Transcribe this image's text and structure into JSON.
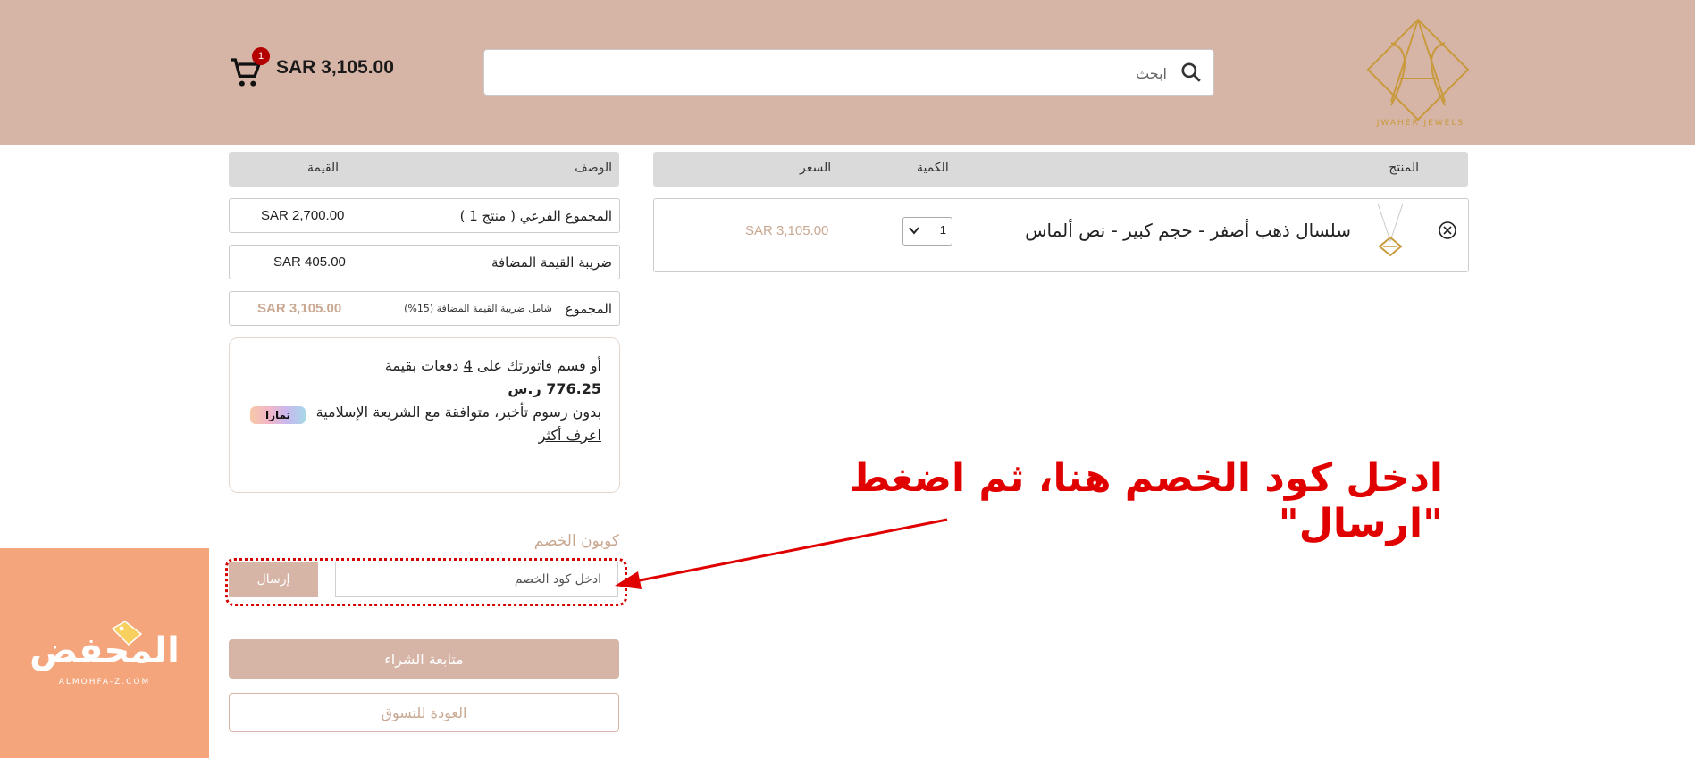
{
  "header": {
    "logo_text": "JWAHER JEWELS",
    "search_placeholder": "ابحث",
    "cart_count": "1",
    "cart_total": "SAR 3,105.00"
  },
  "cart_table": {
    "headers": {
      "product": "المنتج",
      "quantity": "الكمية",
      "price": "السعر"
    },
    "item": {
      "name": "سلسال ذهب أصفر - حجم كبير - نص ألماس",
      "quantity": "1",
      "price": "SAR 3,105.00"
    }
  },
  "summary": {
    "headers": {
      "description": "الوصف",
      "value": "القيمة"
    },
    "subtotal_label": "المجموع الفرعي ( منتج 1 )",
    "subtotal_value": "SAR 2,700.00",
    "vat_label": "ضريبة القيمة المضافة",
    "vat_value": "SAR 405.00",
    "total_label": "المجموع",
    "total_note": "شامل ضريبة القيمة المضافة (15%)",
    "total_value": "SAR 3,105.00"
  },
  "tamara": {
    "line1_pre": "أو قسم فاتورتك على",
    "installments": "4",
    "line1_post": "دفعات بقيمة",
    "amount": "776.25 ر.س",
    "line2": "بدون رسوم تأخير، متوافقة مع الشريعة الإسلامية",
    "learn_more": "اعرف أكثر",
    "logo": "تمارا"
  },
  "coupon": {
    "title": "كوبون الخصم",
    "placeholder": "ادخل كود الخصم",
    "submit": "إرسال"
  },
  "actions": {
    "checkout": "متابعة الشراء",
    "back": "العودة للتسوق"
  },
  "annotation": {
    "text": "ادخل كود الخصم هنا، ثم اضغط \"ارسال\""
  },
  "watermark": {
    "title": "المحفض",
    "subtitle": "ALMOHFA-Z.COM"
  },
  "colors": {
    "header_bg": "#d6b4a6",
    "accent_text": "#c9a892",
    "annotation_red": "#e00000",
    "watermark_bg": "#f4a57c"
  }
}
